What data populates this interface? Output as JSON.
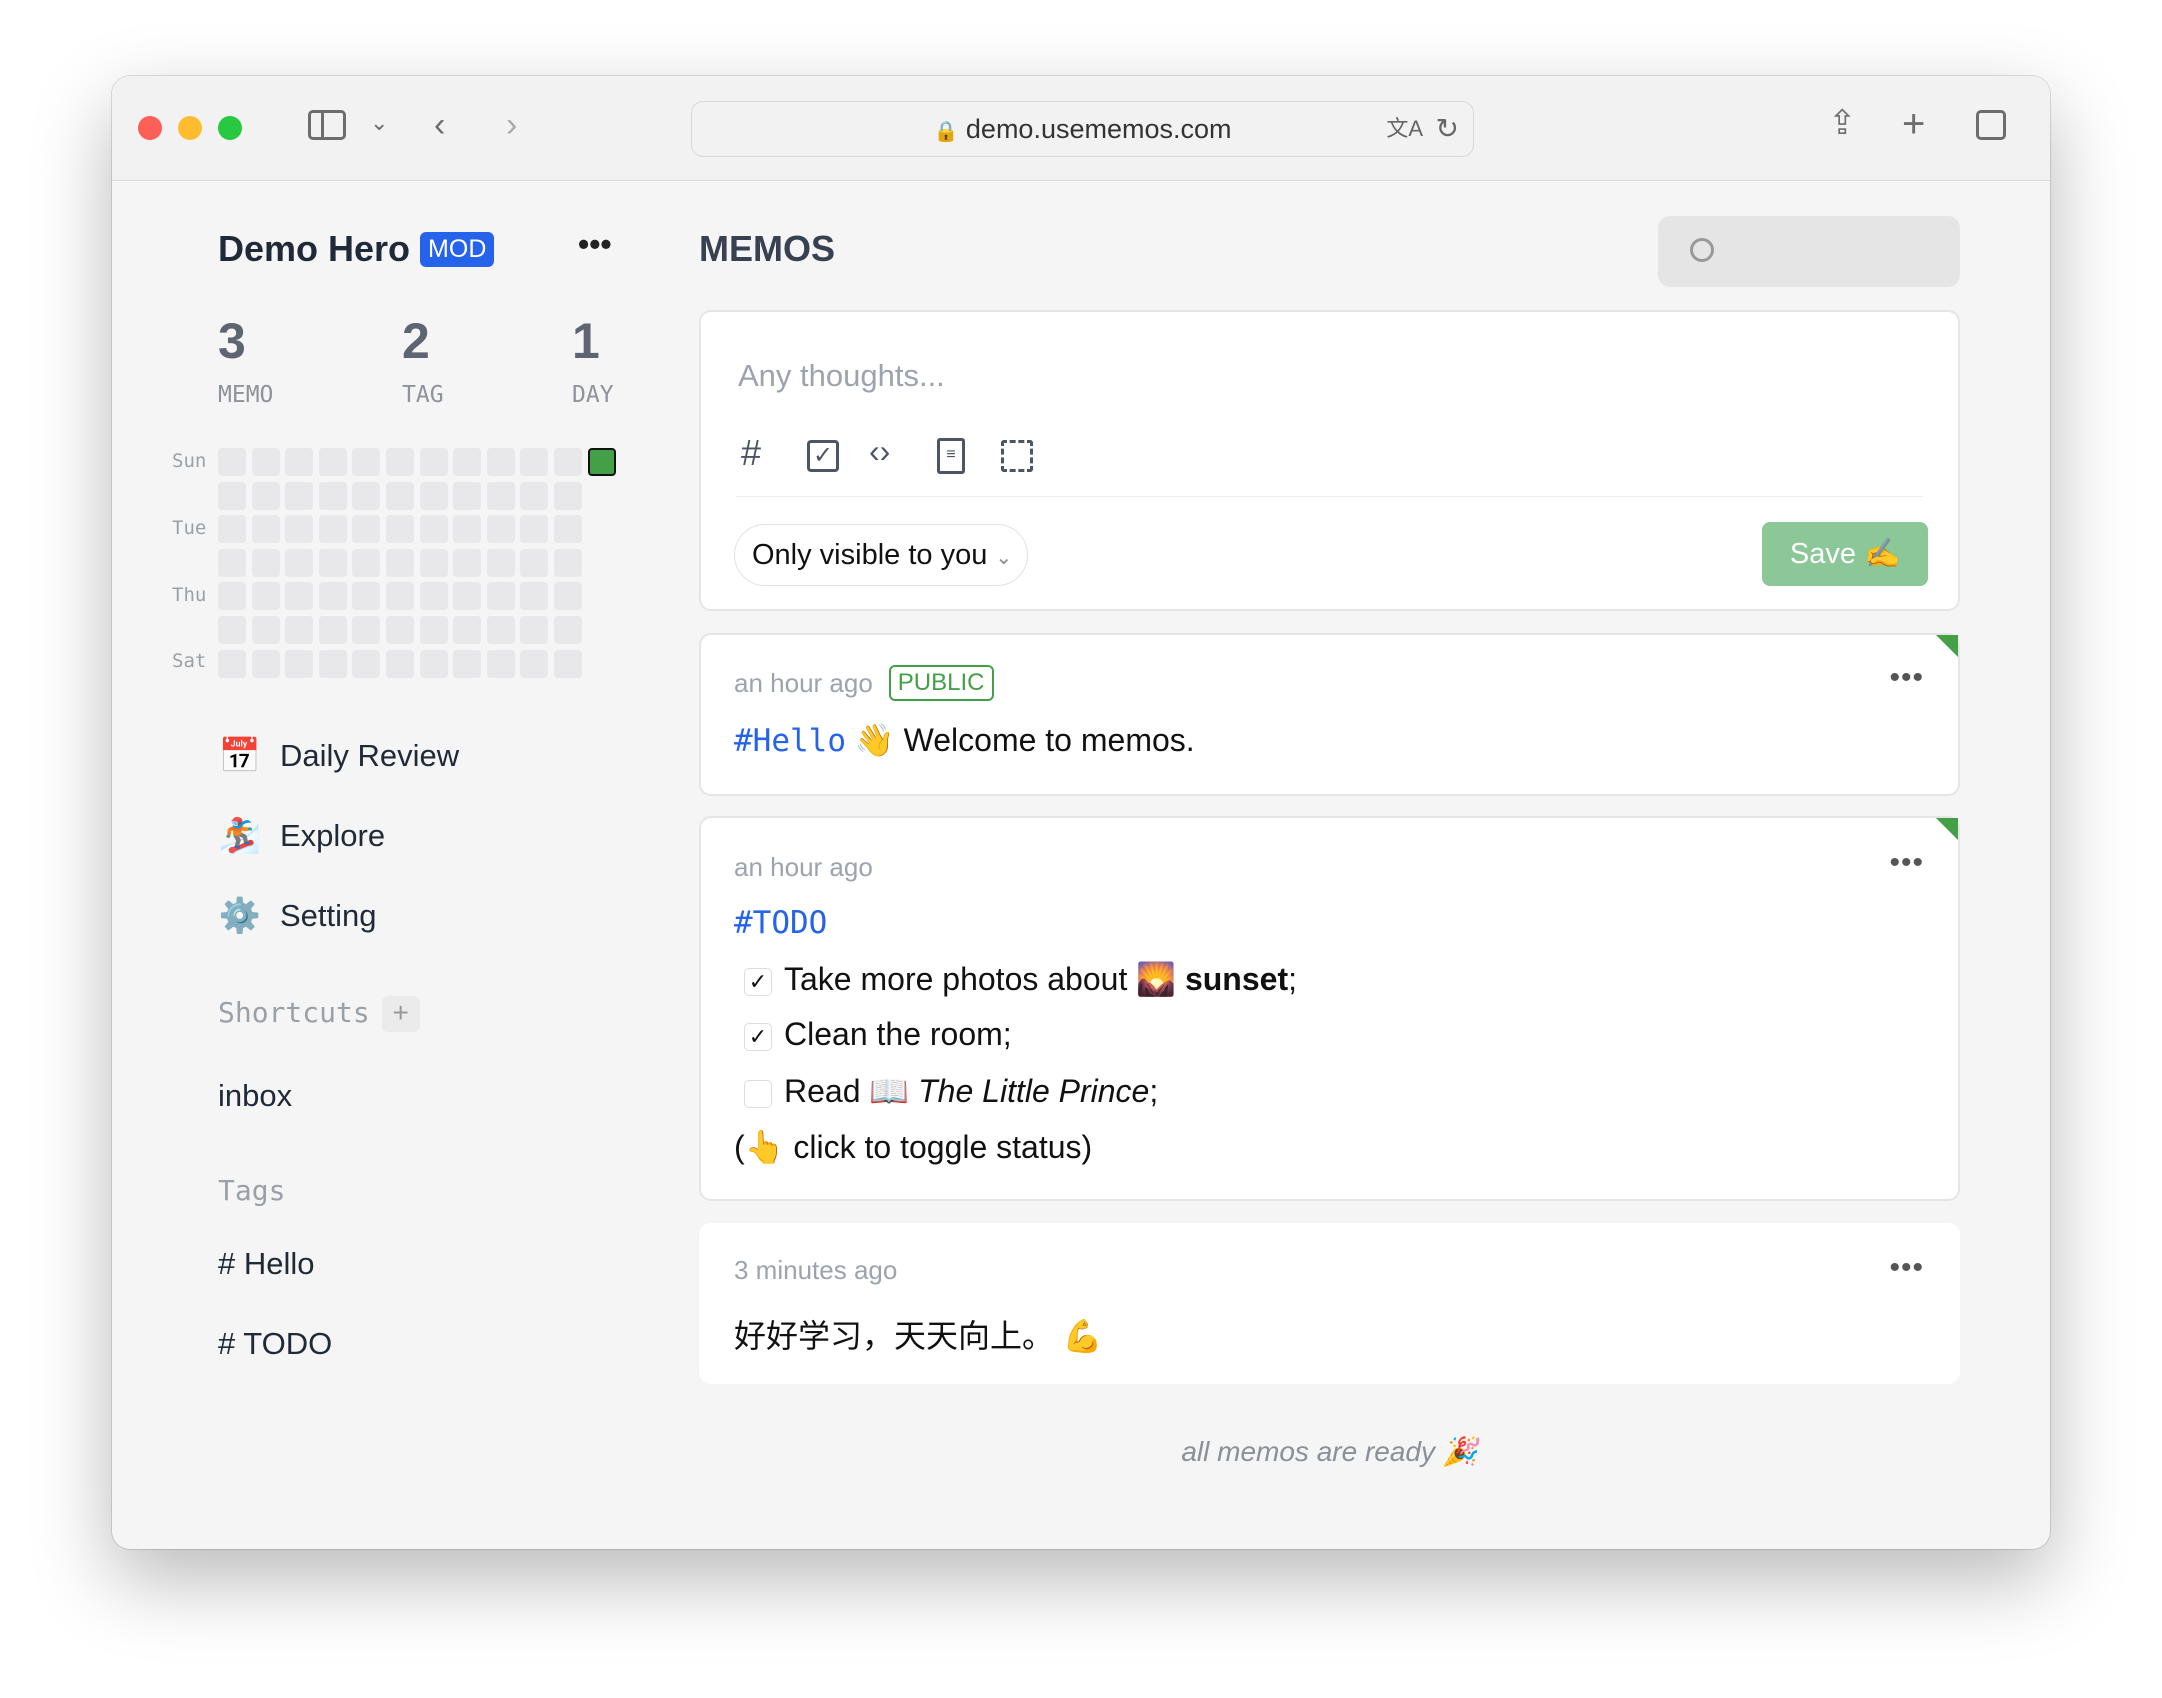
{
  "browser": {
    "url": "demo.usememos.com"
  },
  "sidebar": {
    "user_name": "Demo Hero",
    "role_badge": "MOD",
    "stats": [
      {
        "value": "3",
        "label": "MEMO"
      },
      {
        "value": "2",
        "label": "TAG"
      },
      {
        "value": "1",
        "label": "DAY"
      }
    ],
    "heatmap": {
      "day_labels": [
        "Sun",
        "Tue",
        "Thu",
        "Sat"
      ],
      "weeks": 12,
      "active_color": "#43a047",
      "active_cells": [
        {
          "week": 12,
          "day": "Sun"
        }
      ]
    },
    "menu": [
      {
        "icon": "📅",
        "label": "Daily Review"
      },
      {
        "icon": "🏂",
        "label": "Explore"
      },
      {
        "icon": "⚙️",
        "label": "Setting"
      }
    ],
    "shortcuts_title": "Shortcuts",
    "shortcuts": [
      "inbox"
    ],
    "tags_title": "Tags",
    "tags": [
      "# Hello",
      "# TODO"
    ]
  },
  "main": {
    "title": "MEMOS",
    "editor": {
      "placeholder": "Any thoughts...",
      "visibility": "Only visible to you",
      "save_label": "Save",
      "save_emoji": "✍️"
    },
    "memos": [
      {
        "time": "an hour ago",
        "badge": "PUBLIC",
        "tag": "#Hello",
        "emoji": "👋",
        "text": "Welcome to memos."
      },
      {
        "time": "an hour ago",
        "tag": "#TODO",
        "todos": [
          {
            "checked": true,
            "pre": "Take more photos about",
            "emoji": "🌄",
            "bold": "sunset",
            "post": ";"
          },
          {
            "checked": true,
            "pre": "Clean the room;"
          },
          {
            "checked": false,
            "pre": "Read",
            "emoji": "📖",
            "italic": "The Little Prince",
            "post": ";"
          }
        ],
        "note_open": "(",
        "note_emoji": "👆",
        "note": "click to toggle status)"
      },
      {
        "time": "3 minutes ago",
        "text": "好好学习，天天向上。",
        "emoji": "💪"
      }
    ],
    "footer": "all memos are ready",
    "footer_emoji": "🎉"
  },
  "colors": {
    "accent": "#2563eb",
    "green": "#43a047",
    "save": "#8cc797"
  }
}
